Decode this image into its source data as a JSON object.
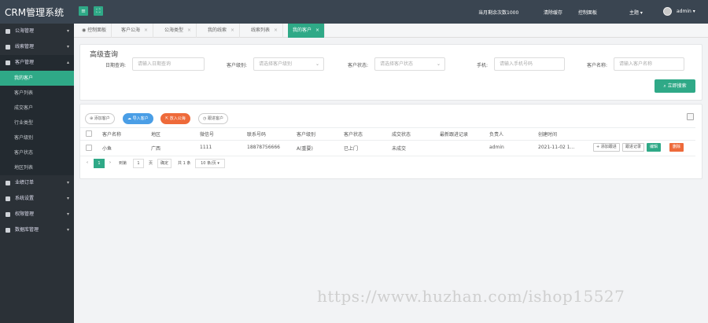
{
  "app": {
    "title": "CRM管理系统"
  },
  "topbar": {
    "notice": "当月剩余次数1000",
    "clear_cache": "清除缓存",
    "control_panel": "控制面板",
    "theme": "主题 ▾",
    "user": "admin ▾"
  },
  "sidebar": {
    "menus": [
      {
        "label": "公海管理",
        "arrow": "▾"
      },
      {
        "label": "线索管理",
        "arrow": "▾"
      },
      {
        "label": "客户管理",
        "arrow": "▴"
      }
    ],
    "sub_items": [
      "我的客户",
      "客户列表",
      "成交客户",
      "行业类型",
      "客户级别",
      "客户状态",
      "地区列表"
    ],
    "menus_after": [
      {
        "label": "业绩订单",
        "arrow": "▾"
      },
      {
        "label": "系统设置",
        "arrow": "▾"
      },
      {
        "label": "权限管理",
        "arrow": "▾"
      },
      {
        "label": "数据库管理",
        "arrow": "▾"
      }
    ]
  },
  "tabs": [
    {
      "label": "控制面板",
      "close": ""
    },
    {
      "label": "客户公海",
      "close": "×"
    },
    {
      "label": "公海类型",
      "close": "×"
    },
    {
      "label": "我的线索",
      "close": "×"
    },
    {
      "label": "线索列表",
      "close": "×"
    },
    {
      "label": "我的客户",
      "close": "×"
    }
  ],
  "search": {
    "title": "高级查询",
    "fields": [
      {
        "label": "日期查询:",
        "placeholder": "请输入日期查询"
      },
      {
        "label": "客户级别:",
        "placeholder": "请选择客户级别"
      },
      {
        "label": "客户状态:",
        "placeholder": "请选择客户状态"
      },
      {
        "label": "手机:",
        "placeholder": "请输入手机号码"
      },
      {
        "label": "客户名称:",
        "placeholder": "请输入客户名称"
      }
    ],
    "submit": "立即搜索"
  },
  "toolbar": {
    "add": "添加客户",
    "import": "导入客户",
    "to_pool": "放入公海",
    "followup": "跟进客户"
  },
  "table": {
    "headers": [
      "客户名称",
      "地区",
      "微信号",
      "联系号码",
      "客户级别",
      "客户状态",
      "成交状态",
      "最新跟进记录",
      "负责人",
      "创建时间"
    ],
    "rows": [
      {
        "cells": [
          "小鱼",
          "广西",
          "1111",
          "18878756666",
          "A(重要)",
          "已上门",
          "未成交",
          "",
          "admin",
          "2021-11-02 1..."
        ],
        "actions": [
          "+ 添加跟进",
          "跟进记录",
          "编辑",
          "删除"
        ]
      }
    ]
  },
  "pager": {
    "current": "1",
    "goto_prefix": "到第",
    "goto_value": "1",
    "goto_suffix": "页",
    "confirm": "确定",
    "total": "共 1 条",
    "per_page": "10 条/页 ▾",
    "prev": "‹",
    "next": "›"
  },
  "watermark": "https://www.huzhan.com/ishop15527"
}
